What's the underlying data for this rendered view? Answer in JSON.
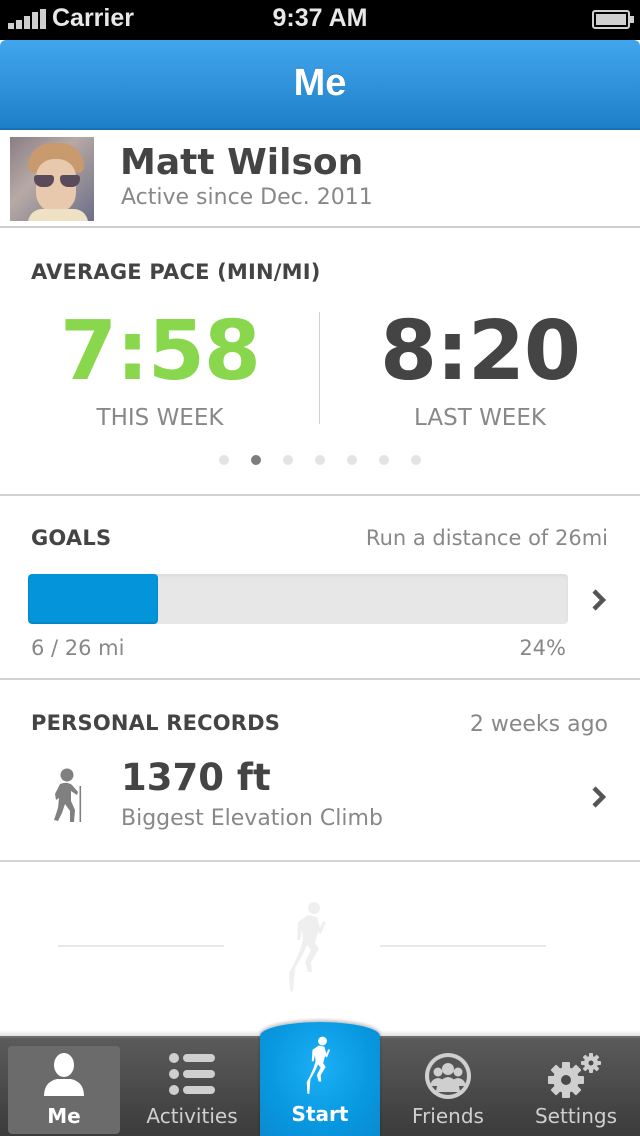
{
  "status_bar": {
    "carrier": "Carrier",
    "time": "9:37 AM",
    "signal_bars": 5,
    "battery_level": 1.0
  },
  "nav": {
    "title": "Me"
  },
  "profile": {
    "name": "Matt Wilson",
    "since": "Active since Dec. 2011",
    "avatar_icon": "user-photo"
  },
  "pace": {
    "title": "AVERAGE PACE (MIN/MI)",
    "this_week": {
      "value": "7:58",
      "label": "THIS WEEK",
      "color": "#88d74c"
    },
    "last_week": {
      "value": "8:20",
      "label": "LAST WEEK",
      "color": "#444444"
    },
    "page_count": 7,
    "page_active_index": 1
  },
  "goals": {
    "title": "GOALS",
    "description": "Run a distance of 26mi",
    "progress_text": "6 / 26 mi",
    "percent_text": "24%",
    "progress_fraction": 0.24,
    "fill_color": "#0394d9"
  },
  "records": {
    "title": "PERSONAL RECORDS",
    "time_ago": "2 weeks ago",
    "value": "1370 ft",
    "label": "Biggest Elevation Climb",
    "icon": "hiker-icon"
  },
  "tab_bar": {
    "tabs": [
      {
        "label": "Me",
        "icon": "person-icon",
        "selected": true
      },
      {
        "label": "Activities",
        "icon": "list-icon",
        "selected": false
      },
      {
        "label": "Start",
        "icon": "runner-icon",
        "selected": false,
        "accent": "#0898e0"
      },
      {
        "label": "Friends",
        "icon": "friends-icon",
        "selected": false
      },
      {
        "label": "Settings",
        "icon": "gears-icon",
        "selected": false
      }
    ]
  }
}
